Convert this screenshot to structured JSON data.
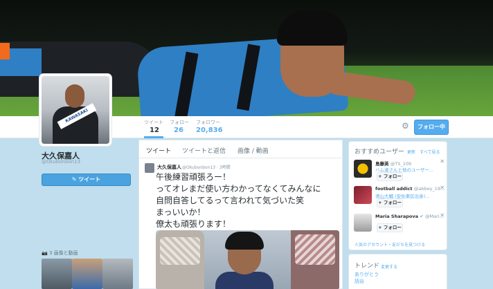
{
  "profile": {
    "name": "大久保嘉人",
    "handle": "@Okubonbon13",
    "avatar_sash_text": "KAWASAKI",
    "tweet_button": "ツイート"
  },
  "stats": [
    {
      "label": "ツイート",
      "value": "12",
      "active": true
    },
    {
      "label": "フォロー",
      "value": "26",
      "active": false
    },
    {
      "label": "フォロワー",
      "value": "20,836",
      "active": false
    }
  ],
  "actions": {
    "follow": "フォロー中",
    "settings_icon": "gear-icon"
  },
  "timeline": {
    "tabs": [
      "ツイート",
      "ツイートと返信",
      "画像 / 動画"
    ],
    "tweet": {
      "author": "大久保嘉人",
      "handle": "@Okubonbon13",
      "time": "3時間",
      "lines": [
        "午後練習頑張ろー！",
        "ってオレまだ使い方わかってなくてみんなに",
        "自問自答してるって言われて気づいた笑",
        "まっいいか！",
        "僚太も頑張ります！"
      ]
    }
  },
  "media": {
    "label": "3 画像と動画"
  },
  "who_to_follow": {
    "title": "おすすめユーザー",
    "refresh": "更新",
    "view_all": "すべて見る",
    "suggestions": [
      {
        "name": "島藤英",
        "handle": "@TS_109",
        "sub": "ハム達さんと他のユーザー...",
        "follow": "フォロー"
      },
      {
        "name": "football addict",
        "handle": "@abbey_19...",
        "sub": "清山大輔 (安佐東区出身)...",
        "follow": "フォロー"
      },
      {
        "name": "Maria Sharapova",
        "handle": "@Mari...",
        "sub": "",
        "follow": "フォロー"
      }
    ],
    "find_friends": "人気のアカウント・友だちを見つける"
  },
  "trends": {
    "title": "トレンド",
    "change": "変更する",
    "items": [
      "ありがとう",
      "読谷"
    ]
  }
}
